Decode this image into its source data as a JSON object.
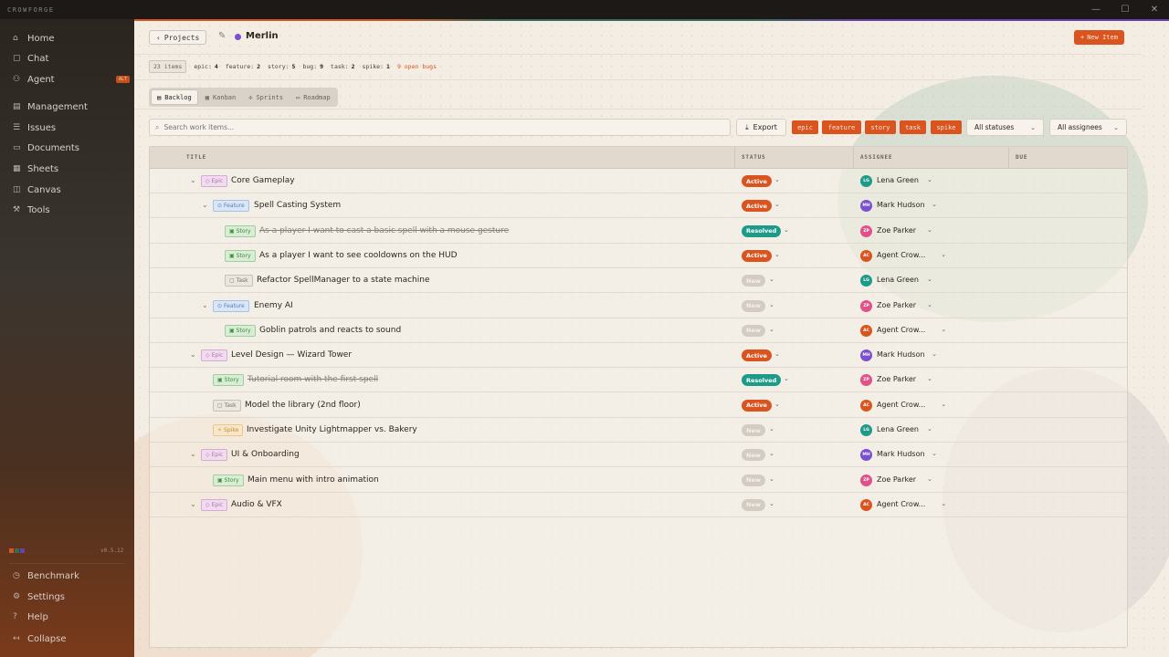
{
  "app": {
    "name": "CROWFORGE",
    "window_controls": [
      "—",
      "☐",
      "✕"
    ]
  },
  "sidebar": {
    "items": [
      {
        "label": "Home",
        "icon": "home-icon"
      },
      {
        "label": "Chat",
        "icon": "chat-icon"
      },
      {
        "label": "Agent",
        "icon": "agent-icon",
        "badge": "ALT"
      },
      {
        "label": "Management",
        "icon": "management-icon"
      },
      {
        "label": "Issues",
        "icon": "issues-icon"
      },
      {
        "label": "Documents",
        "icon": "documents-icon"
      },
      {
        "label": "Sheets",
        "icon": "sheets-icon"
      },
      {
        "label": "Canvas",
        "icon": "canvas-icon"
      },
      {
        "label": "Tools",
        "icon": "tools-icon"
      }
    ],
    "version": "v0.5.12",
    "bottom_items": [
      {
        "label": "Benchmark",
        "icon": "benchmark-icon"
      },
      {
        "label": "Settings",
        "icon": "settings-icon"
      },
      {
        "label": "Help",
        "icon": "help-icon"
      },
      {
        "label": "Collapse",
        "icon": "collapse-icon"
      }
    ]
  },
  "header": {
    "back_label": "Projects",
    "project_name": "Merlin",
    "new_item_label": "New Item"
  },
  "stats": {
    "total": "23 items",
    "items": [
      {
        "label": "epic:",
        "value": "4"
      },
      {
        "label": "feature:",
        "value": "2"
      },
      {
        "label": "story:",
        "value": "5"
      },
      {
        "label": "bug:",
        "value": "9"
      },
      {
        "label": "task:",
        "value": "2"
      },
      {
        "label": "spike:",
        "value": "1"
      }
    ],
    "open_bugs": "9 open bugs"
  },
  "view_tabs": [
    {
      "label": "Backlog",
      "active": true
    },
    {
      "label": "Kanban",
      "active": false
    },
    {
      "label": "Sprints",
      "active": false
    },
    {
      "label": "Roadmap",
      "active": false
    }
  ],
  "toolbar": {
    "search_placeholder": "Search work items...",
    "export_label": "Export",
    "type_filters": [
      "epic",
      "feature",
      "story",
      "task",
      "spike"
    ],
    "status_filter": "All statuses",
    "assignee_filter": "All assignees"
  },
  "table": {
    "columns": [
      "TITLE",
      "STATUS",
      "ASSIGNEE",
      "DUE"
    ],
    "rows": [
      {
        "type": "Epic",
        "title": "Core Gameplay",
        "status": "Active",
        "assignee": "Lena Green",
        "initials": "LG",
        "depth": 0,
        "toggle": true,
        "done": false
      },
      {
        "type": "Feature",
        "title": "Spell Casting System",
        "status": "Active",
        "assignee": "Mark Hudson",
        "initials": "MH",
        "depth": 1,
        "toggle": true,
        "done": false
      },
      {
        "type": "Story",
        "title": "As a player I want to cast a basic spell with a mouse gesture",
        "status": "Resolved",
        "assignee": "Zoe Parker",
        "initials": "ZP",
        "depth": 2,
        "toggle": false,
        "done": true
      },
      {
        "type": "Story",
        "title": "As a player I want to see cooldowns on the HUD",
        "status": "Active",
        "assignee": "Agent Crow...",
        "initials": "AC",
        "depth": 2,
        "toggle": false,
        "done": false
      },
      {
        "type": "Task",
        "title": "Refactor SpellManager to a state machine",
        "status": "New",
        "assignee": "Lena Green",
        "initials": "LG",
        "depth": 2,
        "toggle": false,
        "done": false
      },
      {
        "type": "Feature",
        "title": "Enemy AI",
        "status": "New",
        "assignee": "Zoe Parker",
        "initials": "ZP",
        "depth": 1,
        "toggle": true,
        "done": false
      },
      {
        "type": "Story",
        "title": "Goblin patrols and reacts to sound",
        "status": "New",
        "assignee": "Agent Crow...",
        "initials": "AC",
        "depth": 2,
        "toggle": false,
        "done": false
      },
      {
        "type": "Epic",
        "title": "Level Design — Wizard Tower",
        "status": "Active",
        "assignee": "Mark Hudson",
        "initials": "MH",
        "depth": 0,
        "toggle": true,
        "done": false
      },
      {
        "type": "Story",
        "title": "Tutorial room with the first spell",
        "status": "Resolved",
        "assignee": "Zoe Parker",
        "initials": "ZP",
        "depth": 1,
        "toggle": false,
        "done": true
      },
      {
        "type": "Task",
        "title": "Model the library (2nd floor)",
        "status": "Active",
        "assignee": "Agent Crow...",
        "initials": "AC",
        "depth": 1,
        "toggle": false,
        "done": false
      },
      {
        "type": "Spike",
        "title": "Investigate Unity Lightmapper vs. Bakery",
        "status": "New",
        "assignee": "Lena Green",
        "initials": "LG",
        "depth": 1,
        "toggle": false,
        "done": false
      },
      {
        "type": "Epic",
        "title": "UI & Onboarding",
        "status": "New",
        "assignee": "Mark Hudson",
        "initials": "MH",
        "depth": 0,
        "toggle": true,
        "done": false
      },
      {
        "type": "Story",
        "title": "Main menu with intro animation",
        "status": "New",
        "assignee": "Zoe Parker",
        "initials": "ZP",
        "depth": 1,
        "toggle": false,
        "done": false
      },
      {
        "type": "Epic",
        "title": "Audio & VFX",
        "status": "New",
        "assignee": "Agent Crow...",
        "initials": "AC",
        "depth": 0,
        "toggle": true,
        "done": false
      }
    ]
  },
  "colors": {
    "accent": "#d9541e",
    "resolved": "#1e9a8a",
    "avatar_LG": "#1e9a8a",
    "avatar_MH": "#7a4fd0",
    "avatar_ZP": "#e0508a",
    "avatar_AC": "#d9541e"
  }
}
